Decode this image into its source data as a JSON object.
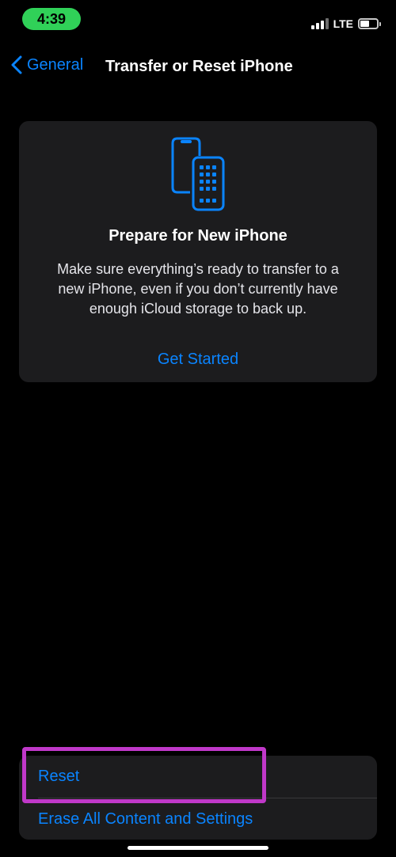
{
  "status_bar": {
    "time": "4:39",
    "network": "LTE"
  },
  "nav": {
    "back_label": "General",
    "title": "Transfer or Reset iPhone"
  },
  "prepare_card": {
    "title": "Prepare for New iPhone",
    "description": "Make sure everything’s ready to transfer to a new iPhone, even if you don’t currently have enough iCloud storage to back up.",
    "action_label": "Get Started",
    "icon": "transfer-phones-icon"
  },
  "settings_list": {
    "items": [
      {
        "label": "Reset"
      },
      {
        "label": "Erase All Content and Settings"
      }
    ]
  },
  "colors": {
    "accent": "#0a84ff",
    "time_pill": "#30d158",
    "card_background": "#1c1c1e",
    "highlight": "#c038c9"
  }
}
